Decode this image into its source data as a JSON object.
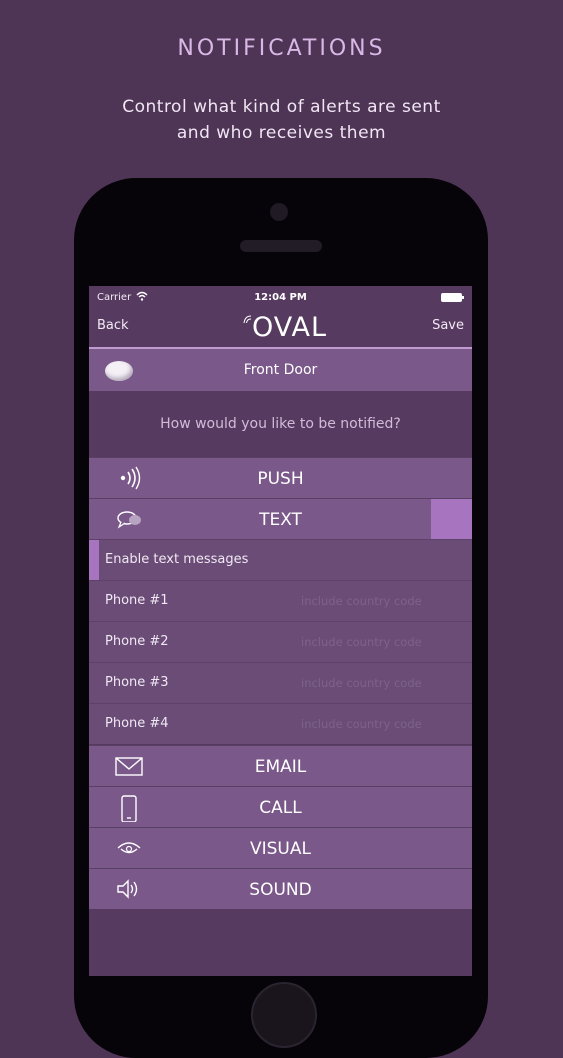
{
  "hero": {
    "title": "NOTIFICATIONS",
    "subtitle_line1": "Control what kind of alerts are sent",
    "subtitle_line2": "and who receives them"
  },
  "status_bar": {
    "carrier": "Carrier",
    "time": "12:04 PM"
  },
  "nav": {
    "back_label": "Back",
    "logo_text": "OVAL",
    "save_label": "Save"
  },
  "device": {
    "name": "Front Door"
  },
  "question": "How would you like to be notified?",
  "channels": {
    "push": "PUSH",
    "text": "TEXT",
    "email": "EMAIL",
    "call": "CALL",
    "visual": "VISUAL",
    "sound": "SOUND"
  },
  "text_settings": {
    "enable_label": "Enable text messages",
    "phones": [
      {
        "label": "Phone #1",
        "placeholder": "include country code"
      },
      {
        "label": "Phone #2",
        "placeholder": "include country code"
      },
      {
        "label": "Phone #3",
        "placeholder": "include country code"
      },
      {
        "label": "Phone #4",
        "placeholder": "include country code"
      }
    ]
  },
  "colors": {
    "background": "#4e3556",
    "row": "#7a5889",
    "accent": "#a774bf",
    "title": "#d9b8e6"
  },
  "icons": {
    "push": "push-signal-icon",
    "text": "chat-bubble-icon",
    "email": "envelope-icon",
    "call": "phone-icon",
    "visual": "eye-icon",
    "sound": "speaker-icon"
  }
}
